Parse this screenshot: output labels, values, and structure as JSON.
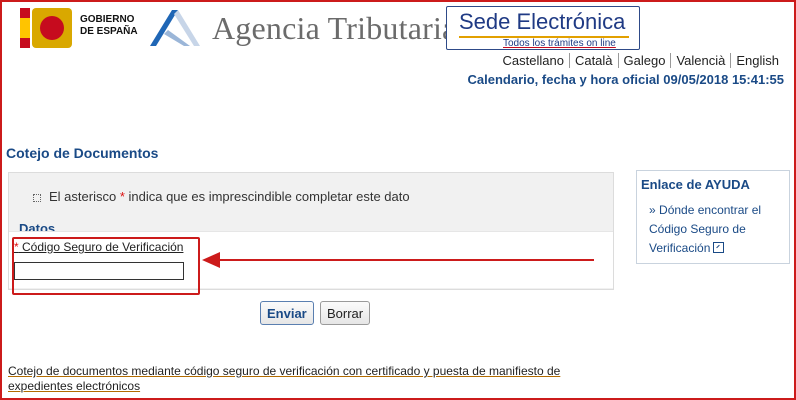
{
  "header": {
    "gov_logo_text": [
      "GOBIERNO",
      "DE ESPAÑA"
    ],
    "agency_title": "Agencia Tributaria",
    "sede_title_part1": "Sede ",
    "sede_title_part2": "Electrónica",
    "sede_subtitle": "Todos los trámites on line"
  },
  "languages": [
    "Castellano",
    "Català",
    "Galego",
    "Valencià",
    "English"
  ],
  "calendar_text": "Calendario, fecha y hora oficial 09/05/2018 15:41:55",
  "page": {
    "title": "Cotejo de Documentos",
    "note_before": "El asterisco ",
    "note_asterisk": "*",
    "note_after": " indica que es imprescindible completar este dato",
    "section_label": "Datos",
    "field_asterisk": "*",
    "field_label": "Código Seguro de Verificación",
    "field_value": "",
    "buttons": {
      "send": "Enviar",
      "clear": "Borrar"
    },
    "footer_link": "Cotejo de documentos mediante código seguro de verificación con certificado y puesta de manifiesto de expedientes electrónicos"
  },
  "help": {
    "title": "Enlace de AYUDA",
    "bullet": "»",
    "link_text": "Dónde encontrar el Código Seguro de Verificación"
  },
  "colors": {
    "primary_blue": "#1a4a86",
    "annotation_red": "#cc1b1b",
    "form_bg": "#f1f1f1"
  }
}
